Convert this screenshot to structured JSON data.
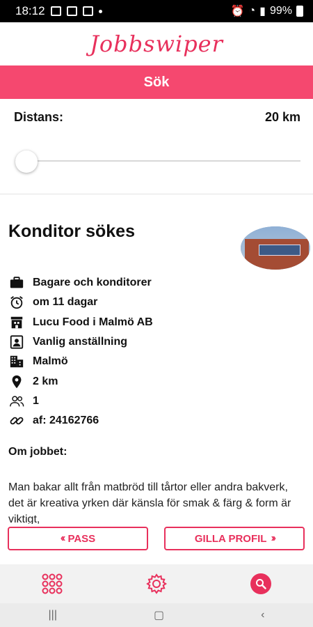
{
  "status_bar": {
    "time": "18:12",
    "battery": "99%"
  },
  "app": {
    "title": "Jobbswiper",
    "search_label": "Sök"
  },
  "distance": {
    "label": "Distans:",
    "value": "20 km",
    "slider_fraction": 0.0
  },
  "job": {
    "title": "Konditor sökes",
    "details": {
      "category": "Bagare och konditorer",
      "deadline": "om 11 dagar",
      "employer": "Lucu Food i Malmö AB",
      "employment_type": "Vanlig anställning",
      "city": "Malmö",
      "distance": "2 km",
      "positions": "1",
      "reference": "af: 24162766"
    },
    "about_heading": "Om jobbet:",
    "about_text": "Man bakar allt från matbröd till tårtor eller andra bakverk, det är kreativa yrken där känsla för smak & färg & form är viktigt,"
  },
  "actions": {
    "pass_label": "PASS",
    "like_label": "GILLA PROFIL"
  },
  "colors": {
    "accent": "#e8305c",
    "search_bar": "#f5486f"
  },
  "icons": {
    "category": "briefcase-icon",
    "deadline": "alarm-clock-icon",
    "employer": "store-icon",
    "employment_type": "person-badge-icon",
    "city": "city-icon",
    "distance": "location-pin-icon",
    "positions": "people-icon",
    "reference": "link-icon",
    "nav_left": "grid-icon",
    "nav_center": "gear-icon",
    "nav_right": "search-icon"
  }
}
